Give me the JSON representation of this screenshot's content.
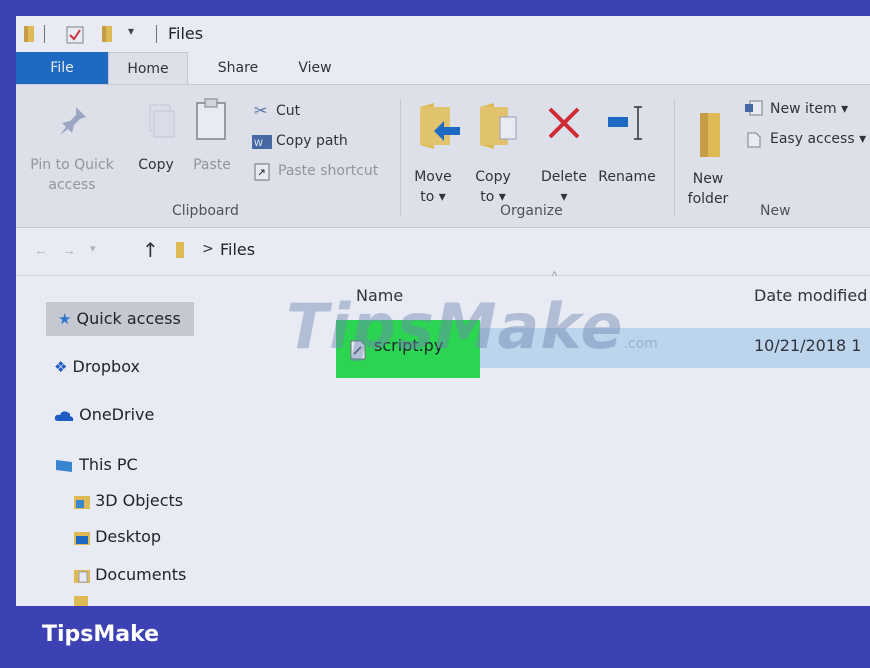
{
  "titlebar": {
    "title": "Files"
  },
  "tabs": [
    {
      "label": "File"
    },
    {
      "label": "Home"
    },
    {
      "label": "Share"
    },
    {
      "label": "View"
    }
  ],
  "ribbon": {
    "clipboard": {
      "pin_line1": "Pin to Quick",
      "pin_line2": "access",
      "copy": "Copy",
      "paste": "Paste",
      "cut": "Cut",
      "copy_path": "Copy path",
      "paste_shortcut": "Paste shortcut",
      "group_label": "Clipboard"
    },
    "organize": {
      "move_line1": "Move",
      "move_line2": "to ▾",
      "copy_line1": "Copy",
      "copy_line2": "to ▾",
      "delete_line1": "Delete",
      "delete_line2": "▾",
      "rename": "Rename",
      "group_label": "Organize"
    },
    "new": {
      "folder_line1": "New",
      "folder_line2": "folder",
      "new_item": "New item ▾",
      "easy_access": "Easy access ▾",
      "group_label": "New"
    }
  },
  "address": {
    "path_sep": ">",
    "path": "Files"
  },
  "nav": {
    "items": [
      {
        "label": "Quick access",
        "icon": "star-icon"
      },
      {
        "label": "Dropbox",
        "icon": "dropbox-icon"
      },
      {
        "label": "OneDrive",
        "icon": "cloud-icon"
      },
      {
        "label": "This PC",
        "icon": "computer-icon"
      },
      {
        "label": "3D Objects",
        "icon": "cube-folder-icon"
      },
      {
        "label": "Desktop",
        "icon": "desktop-folder-icon"
      },
      {
        "label": "Documents",
        "icon": "documents-folder-icon"
      }
    ]
  },
  "content": {
    "columns": {
      "name": "Name",
      "date": "Date modified"
    },
    "rows": [
      {
        "name": "script.py",
        "date": "10/21/2018 1"
      }
    ]
  },
  "watermark": {
    "text": "TipsMake",
    "suffix": ".com"
  },
  "footer": {
    "brand": "TipsMake"
  },
  "colors": {
    "frame": "#3c41b3",
    "file_tab": "#1e70c9",
    "highlight": "#2ce64a",
    "folder": "#f2c94c",
    "selection": "#cde6f7"
  }
}
